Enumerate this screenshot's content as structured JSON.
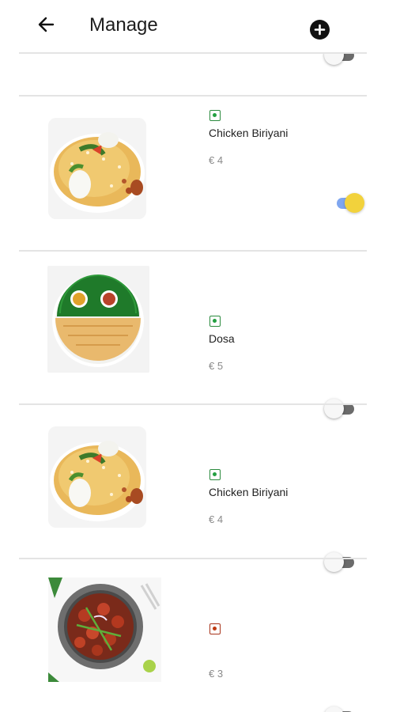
{
  "header": {
    "title": "Manage",
    "back_icon": "arrow-left-icon",
    "add_icon": "plus-circle-icon"
  },
  "items": [
    {
      "name": "Chicken Biriyani",
      "price": "€ 4",
      "diet": "veg",
      "available": true,
      "image": "biryani-plate"
    },
    {
      "name": "Dosa",
      "price": "€ 5",
      "diet": "veg",
      "available": false,
      "image": "dosa-plate"
    },
    {
      "name": "Chicken Biriyani",
      "price": "€ 4",
      "diet": "veg",
      "available": false,
      "image": "biryani-plate"
    },
    {
      "name": "",
      "price": "€ 3",
      "diet": "non-veg",
      "available": false,
      "image": "chilli-chicken-bowl"
    }
  ],
  "colors": {
    "veg": "#23a041",
    "non_veg": "#bf3a12",
    "toggle_on_track": "#7fa6ef",
    "toggle_on_knob": "#f2d23c",
    "toggle_off_track": "#6b6b6b"
  }
}
